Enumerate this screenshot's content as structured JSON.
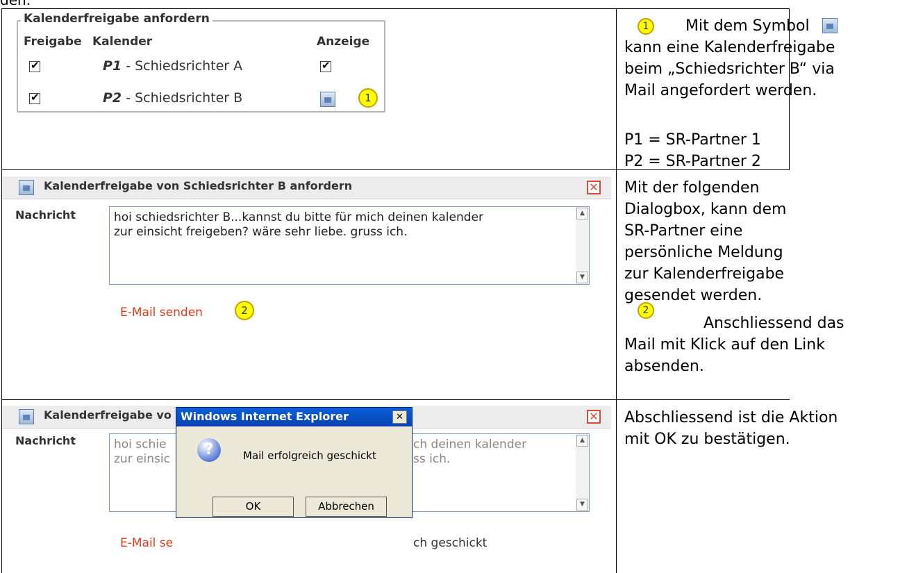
{
  "top_fragment": "den.",
  "row1": {
    "panel": {
      "legend": "Kalenderfreigabe anfordern",
      "col_freigabe": "Freigabe",
      "col_kalender": "Kalender",
      "col_anzeige": "Anzeige",
      "partners": [
        {
          "code": "P1",
          "name": " - Schiedsrichter A"
        },
        {
          "code": "P2",
          "name": " - Schiedsrichter B"
        }
      ],
      "badge": "1"
    },
    "desc": {
      "badge": "1",
      "line1": "Mit dem Symbol",
      "line2": "kann eine Kalenderfreigabe",
      "line3": "beim „Schiedsrichter B“ via",
      "line4": "Mail angefordert werden.",
      "p1": "P1 = SR-Partner 1",
      "p2": "P2 = SR-Partner 2"
    }
  },
  "row2": {
    "dialog": {
      "title": "Kalenderfreigabe von Schiedsrichter B anfordern",
      "label": "Nachricht",
      "message": "hoi schiedsrichter B...kannst du bitte für mich deinen kalender\nzur einsicht freigeben? wäre sehr liebe. gruss ich.",
      "link": "E-Mail senden",
      "badge": "2"
    },
    "desc": {
      "para1": "Mit der folgenden Dialogbox, kann dem SR-Partner eine persönliche Meldung zur Kalenderfreigabe gesendet werden.",
      "badge": "2",
      "line1": "Anschliessend das",
      "line2": "Mail mit Klick auf den Link",
      "line3": "absenden."
    }
  },
  "row3": {
    "dialog": {
      "title_visible": "Kalenderfreigabe vo",
      "label": "Nachricht",
      "msg_left": "hoi schie\nzur einsic",
      "msg_right": "ch deinen kalender\nss ich.",
      "link_visible": "E-Mail se",
      "status_visible": "ch geschickt"
    },
    "messagebox": {
      "title": "Windows Internet Explorer",
      "close": "✕",
      "icon": "?",
      "text": "Mail erfolgreich geschickt",
      "ok": "OK",
      "cancel": "Abbrechen"
    },
    "desc": {
      "line1": "Abschliessend ist die Aktion",
      "line2": "mit OK zu bestätigen."
    }
  }
}
